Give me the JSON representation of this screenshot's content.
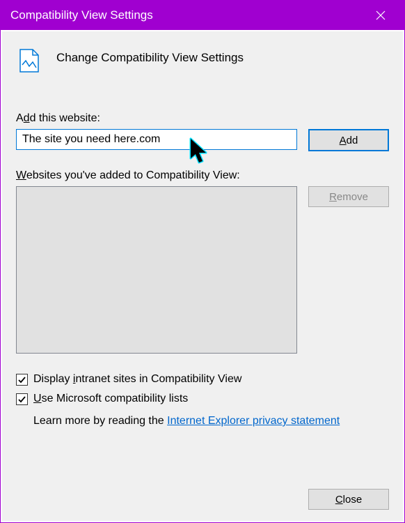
{
  "titlebar": {
    "title": "Compatibility View Settings"
  },
  "header": {
    "text": "Change Compatibility View Settings"
  },
  "addSection": {
    "label_pre": "A",
    "label_underline": "d",
    "label_post": "d this website:",
    "inputValue": "The site you need here.com",
    "addButton_underline": "A",
    "addButton_post": "dd"
  },
  "listSection": {
    "label_underline": "W",
    "label_post": "ebsites you've added to Compatibility View:",
    "removeButton_underline": "R",
    "removeButton_post": "emove"
  },
  "checkboxes": {
    "intranet_pre": "Display ",
    "intranet_underline": "i",
    "intranet_post": "ntranet sites in Compatibility View",
    "mslist_underline": "U",
    "mslist_post": "se Microsoft compatibility lists",
    "intranet_checked": true,
    "mslist_checked": true
  },
  "learnMore": {
    "pre": "Learn more by reading the ",
    "link": "Internet Explorer privacy statement"
  },
  "footer": {
    "closeButton_underline": "C",
    "closeButton_post": "lose"
  }
}
